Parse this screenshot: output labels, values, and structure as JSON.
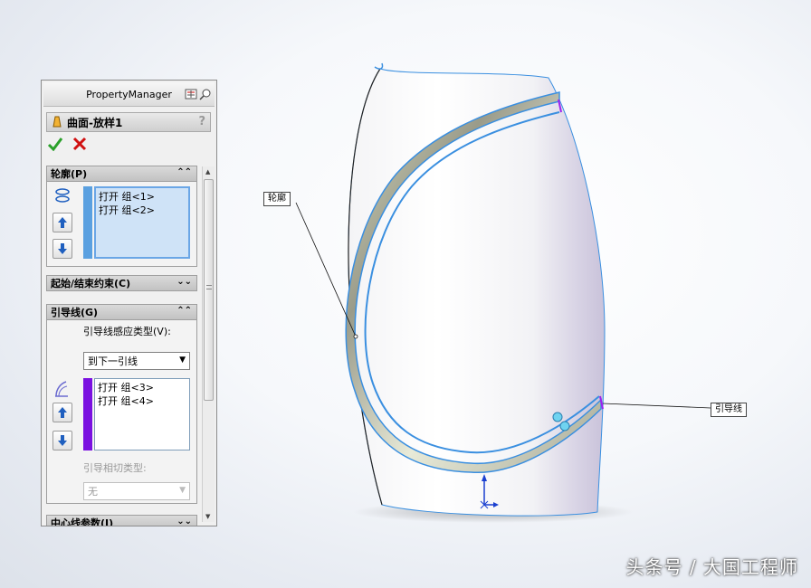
{
  "property_manager": {
    "title": "PropertyManager",
    "feature_title": "曲面-放样1",
    "help_label": "?",
    "profiles": {
      "header": "轮廓(P)",
      "items": [
        "打开 组<1>",
        "打开 组<2>"
      ]
    },
    "start_end": {
      "header": "起始/结束约束(C)"
    },
    "guides": {
      "header": "引导线(G)",
      "influence_label": "引导线感应类型(V):",
      "influence_value": "到下一引线",
      "items": [
        "打开 组<3>",
        "打开 组<4>"
      ],
      "tangency_label": "引导相切类型:",
      "tangency_value": "无"
    },
    "centerline": {
      "header": "中心线参数(I)"
    }
  },
  "viewport": {
    "callout_profile": "轮廓",
    "callout_guide": "引导线"
  },
  "watermark": "头条号 / 大国工程师",
  "colors": {
    "profile_bar": "#5aa0e0",
    "guide_bar": "#7a10e0",
    "edge_highlight": "#3a8fe0",
    "ok": "#2aa02a",
    "cancel": "#d01010"
  }
}
